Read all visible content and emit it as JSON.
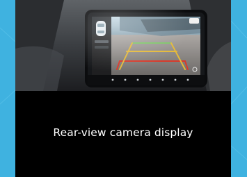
{
  "caption": "Rear-view camera display",
  "photo": {
    "subject": "infotainment-screen-rear-camera",
    "colors": {
      "page_background": "#3fb2e0",
      "card_background": "#000000",
      "guide_near": "#d93a2b",
      "guide_mid": "#e4b93a",
      "guide_far": "#7fc46a"
    }
  }
}
